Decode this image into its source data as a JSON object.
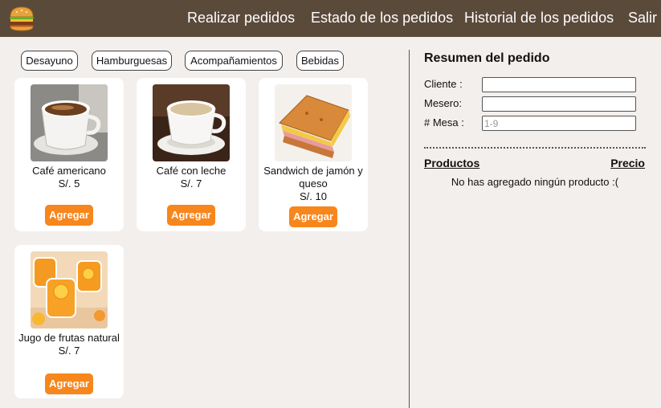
{
  "header": {
    "logo_icon": "burger-icon",
    "nav": [
      {
        "label": "Realizar pedidos"
      },
      {
        "label": "Estado de los pedidos"
      },
      {
        "label": "Historial de los pedidos"
      },
      {
        "label": "Salir"
      }
    ]
  },
  "categories": [
    {
      "label": "Desayuno"
    },
    {
      "label": "Hamburguesas"
    },
    {
      "label": "Acompañamientos"
    },
    {
      "label": "Bebidas"
    }
  ],
  "products": [
    {
      "name": "Café americano",
      "price": "S/. 5",
      "add_label": "Agregar",
      "image_icon": "coffee-cup-photo"
    },
    {
      "name": "Café con leche",
      "price": "S/. 7",
      "add_label": "Agregar",
      "image_icon": "latte-cup-photo"
    },
    {
      "name": "Sandwich de jamón y queso",
      "price": "S/. 10",
      "add_label": "Agregar",
      "image_icon": "sandwich-photo"
    },
    {
      "name": "Jugo de frutas natural",
      "price": "S/. 7",
      "add_label": "Agregar",
      "image_icon": "juice-jars-photo"
    }
  ],
  "summary": {
    "title": "Resumen del pedido",
    "client_label": "Cliente :",
    "client_value": "",
    "waiter_label": "Mesero:",
    "waiter_value": "",
    "table_label": "# Mesa :",
    "table_placeholder": "1-9",
    "products_header": "Productos",
    "price_header": "Precio",
    "empty_message": "No has agregado ningún producto :("
  },
  "colors": {
    "header_bg": "#5a4a3a",
    "page_bg": "#f3efec",
    "accent": "#f7861c"
  }
}
